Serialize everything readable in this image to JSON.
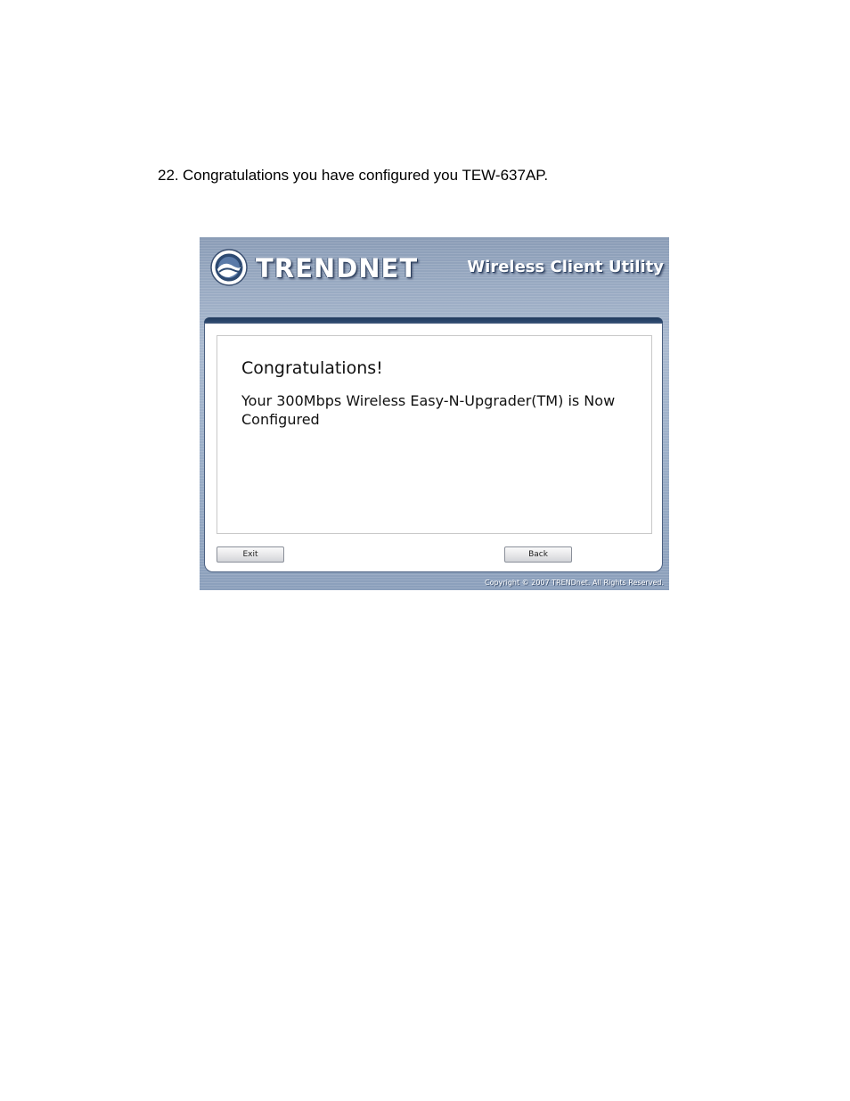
{
  "step": {
    "number": "22.",
    "text": "Congratulations you have configured you TEW-637AP."
  },
  "window": {
    "brand": "TRENDNET",
    "title": "Wireless Client Utility",
    "heading": "Congratulations!",
    "message": "Your 300Mbps Wireless Easy-N-Upgrader(TM) is Now Configured",
    "buttons": {
      "exit": "Exit",
      "back": "Back"
    },
    "copyright": "Copyright © 2007 TRENDnet. All Rights Reserved."
  },
  "icons": {
    "logo": "trendnet-logo-icon"
  },
  "colors": {
    "header_blue": "#9cafc8",
    "strip_dark": "#203a5c"
  }
}
